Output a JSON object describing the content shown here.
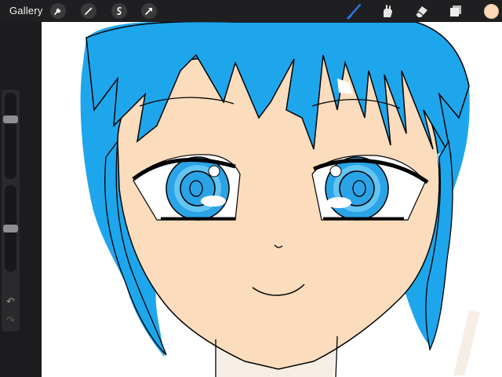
{
  "topbar": {
    "gallery_label": "Gallery",
    "actions": [
      {
        "icon": "wrench-icon"
      },
      {
        "icon": "magic-wand-icon"
      },
      {
        "icon": "selection-icon"
      },
      {
        "icon": "transform-arrow-icon"
      }
    ],
    "tools": [
      {
        "icon": "brush-icon",
        "active": true
      },
      {
        "icon": "smudge-icon",
        "active": false
      },
      {
        "icon": "eraser-icon",
        "active": false
      },
      {
        "icon": "layers-icon",
        "active": false
      }
    ],
    "current_color": "#fbd9b6",
    "accent_color": "#2f7bf5"
  },
  "sidebar": {
    "brush_size_level": 0.71,
    "brush_opacity_level": 0.5,
    "undo_icon": "undo-icon",
    "redo_icon": "redo-icon"
  },
  "canvas": {
    "background": "#ffffff",
    "colors": {
      "hair": "#1ea6ec",
      "hair_light": "#88d4f6",
      "skin": "#fbdcbd",
      "iris": "#2ba3e7",
      "iris_light": "#62c5f2",
      "outline": "#000000"
    }
  }
}
